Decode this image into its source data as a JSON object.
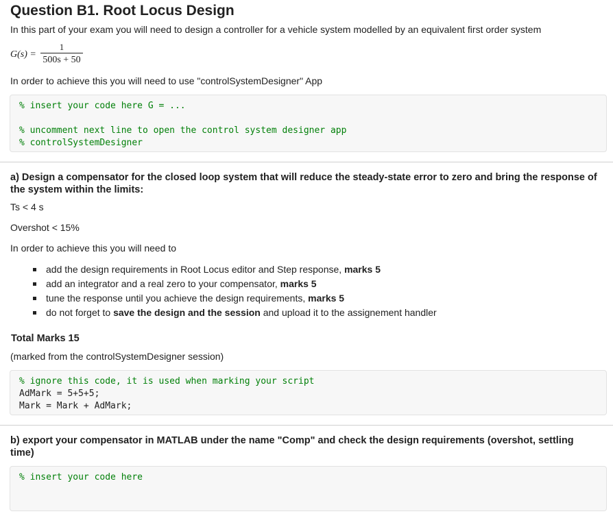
{
  "title": "Question B1. Root Locus Design",
  "intro": "In this part of your exam you will need to design a controller for a vehicle system modelled by an equivalent first order system",
  "formula": {
    "lhs": "G(s) =",
    "numerator": "1",
    "denominator": "500s + 50"
  },
  "instruction_app": "In order to achieve this you will need to use \"controlSystemDesigner\" App",
  "code_block_1": [
    {
      "text": "% insert your code here G = ...",
      "type": "comment"
    },
    {
      "text": "",
      "type": "plain"
    },
    {
      "text": "% uncomment next line to open the control system designer app",
      "type": "comment"
    },
    {
      "text": "% controlSystemDesigner",
      "type": "comment"
    }
  ],
  "part_a": {
    "heading": "a) Design a compensator for the closed loop system that will reduce the steady-state error to zero and bring the response of the system within the limits:",
    "limit_ts": "Ts < 4 s",
    "limit_overshot": "Overshot < 15%",
    "lead_in": "In order to achieve this you will need to",
    "requirements": [
      {
        "text": "add the design requirements in Root Locus editor and Step response, ",
        "bold": "marks 5",
        "tail": ""
      },
      {
        "text": "add an integrator and a real zero to your compensator, ",
        "bold": "marks 5",
        "tail": ""
      },
      {
        "text": "tune the response until you achieve the design requirements, ",
        "bold": "marks 5",
        "tail": ""
      },
      {
        "text": "do not forget to ",
        "bold": "save the design and the session",
        "tail": " and upload it to the assignement handler"
      }
    ],
    "total_marks": "Total Marks 15",
    "marked_from": "(marked from the controlSystemDesigner session)"
  },
  "code_block_2": [
    {
      "text": "% ignore this code, it is used when marking your script",
      "type": "comment"
    },
    {
      "text": "AdMark = 5+5+5;",
      "type": "plain"
    },
    {
      "text": "Mark = Mark + AdMark;",
      "type": "plain"
    }
  ],
  "part_b": {
    "heading": "b) export your compensator in MATLAB under the name \"Comp\" and check the design requirements (overshot, settling time)"
  },
  "code_block_3": [
    {
      "text": "% insert your code here",
      "type": "comment"
    }
  ],
  "colors": {
    "comment": "#028009",
    "code_background": "#f7f7f7",
    "code_border": "#e2e2e2",
    "text": "#212121"
  }
}
